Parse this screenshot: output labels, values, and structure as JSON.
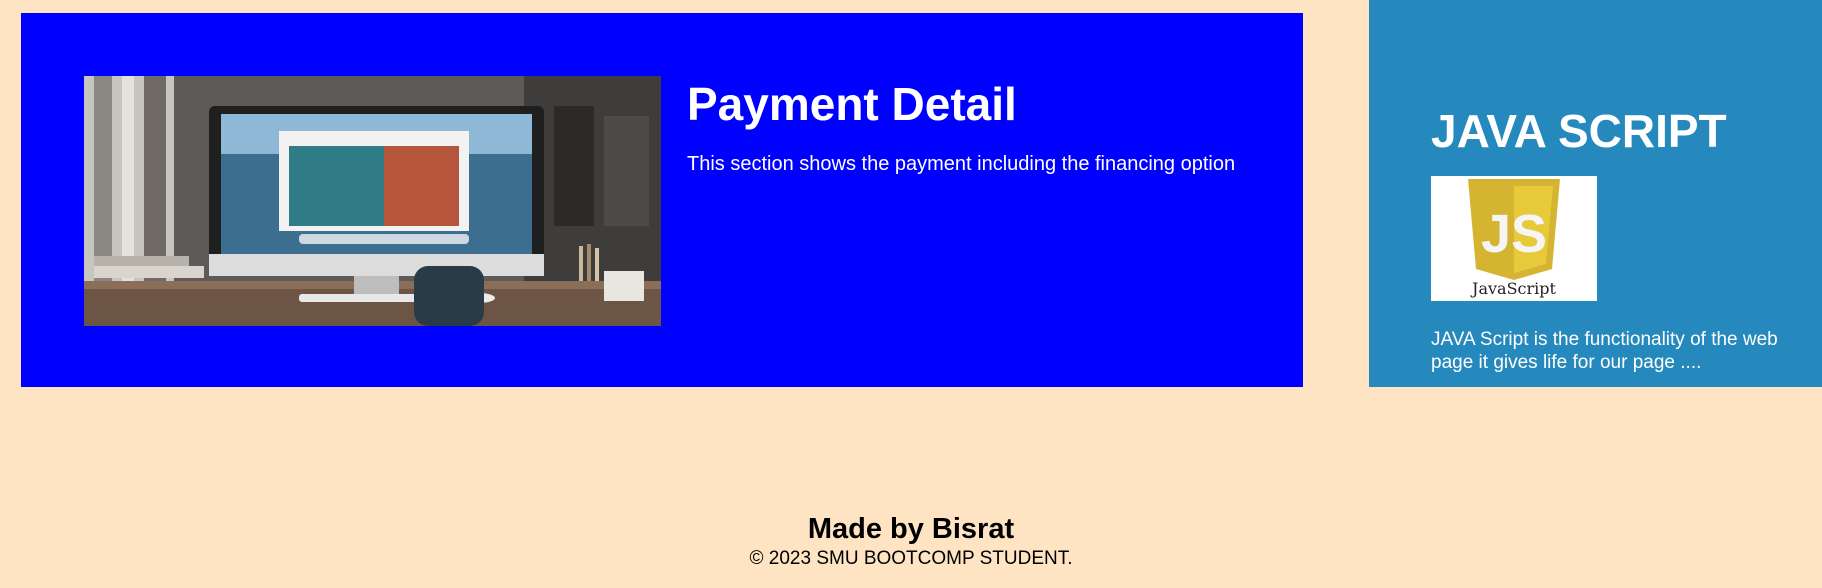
{
  "payment_section": {
    "title": "Payment Detail",
    "description": "This section shows the payment including the financing option",
    "background_color": "#0000ff"
  },
  "javascript_section": {
    "title": "JAVA SCRIPT",
    "logo_mark": "JS",
    "logo_caption": "JavaScript",
    "description": "JAVA Script is the functionality of the web page it gives life for our page ....",
    "background_color": "#2589bd"
  },
  "footer": {
    "title": "Made by Bisrat",
    "copyright": "© 2023 SMU BOOTCOMP STUDENT."
  },
  "page": {
    "background_color": "#ffe4c4"
  }
}
